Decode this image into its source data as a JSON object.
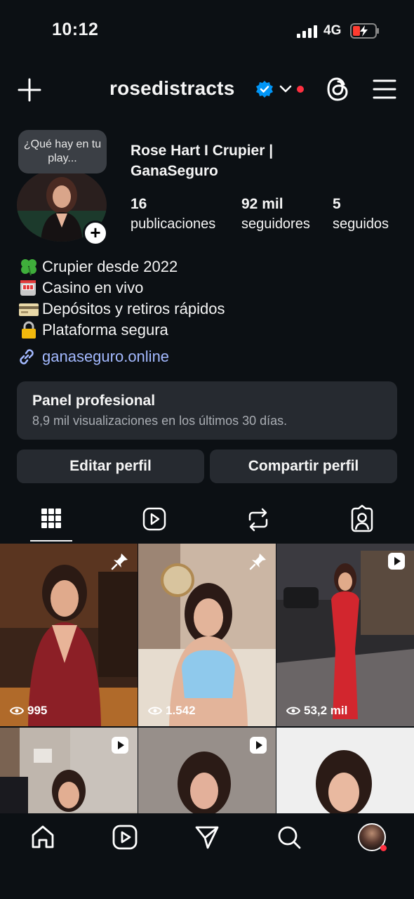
{
  "status_bar": {
    "time": "10:12",
    "network": "4G"
  },
  "header": {
    "username": "rosedistracts"
  },
  "profile": {
    "note": "¿Qué hay en tu play...",
    "display_name": "Rose Hart I Crupier | GanaSeguro",
    "stats": [
      {
        "number": "16",
        "label": "publicaciones"
      },
      {
        "number": "92 mil",
        "label": "seguidores"
      },
      {
        "number": "5",
        "label": "seguidos"
      }
    ],
    "bio": [
      {
        "icon": "clover-icon",
        "text": "Crupier desde 2022"
      },
      {
        "icon": "slot-machine-icon",
        "text": "Casino en vivo"
      },
      {
        "icon": "credit-card-icon",
        "text": "Depósitos y retiros rápidos"
      },
      {
        "icon": "lock-icon",
        "text": "Plataforma segura"
      }
    ],
    "link": "ganaseguro.online"
  },
  "panel": {
    "title": "Panel profesional",
    "subtitle": "8,9 mil visualizaciones en los últimos 30 días."
  },
  "buttons": {
    "edit": "Editar perfil",
    "share": "Compartir perfil"
  },
  "tabs": [
    {
      "icon": "grid-icon",
      "selected": true
    },
    {
      "icon": "reels-icon",
      "selected": false
    },
    {
      "icon": "reposts-icon",
      "selected": false
    },
    {
      "icon": "tagged-icon",
      "selected": false
    }
  ],
  "posts": [
    {
      "views": "995",
      "badge": "pin-icon"
    },
    {
      "views": "1.542",
      "badge": "pin-icon"
    },
    {
      "views": "53,2 mil",
      "badge": "reel-icon"
    },
    {
      "views": "",
      "badge": "reel-icon"
    },
    {
      "views": "",
      "badge": "reel-icon"
    },
    {
      "views": "",
      "badge": ""
    }
  ],
  "bottom_nav": [
    "home-icon",
    "reels-icon",
    "send-icon",
    "search-icon",
    "profile-avatar"
  ],
  "colors": {
    "background": "#0c1014",
    "surface": "#262a30",
    "link": "#a3b9ff",
    "verified": "#0095f6",
    "notification": "#ff3040"
  }
}
